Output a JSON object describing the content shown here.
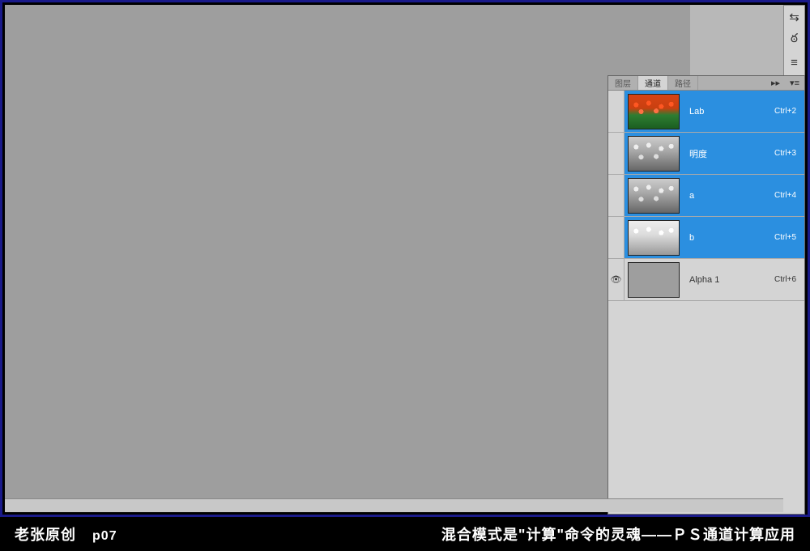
{
  "panel": {
    "tabs": {
      "layers": "图层",
      "channels": "通道",
      "paths": "路径"
    }
  },
  "channels": [
    {
      "name": "Lab",
      "shortcut": "Ctrl+2",
      "selected": true,
      "visible": false,
      "thumb": "color"
    },
    {
      "name": "明度",
      "shortcut": "Ctrl+3",
      "selected": true,
      "visible": false,
      "thumb": "gray"
    },
    {
      "name": "a",
      "shortcut": "Ctrl+4",
      "selected": true,
      "visible": false,
      "thumb": "gray"
    },
    {
      "name": "b",
      "shortcut": "Ctrl+5",
      "selected": true,
      "visible": false,
      "thumb": "light"
    },
    {
      "name": "Alpha 1",
      "shortcut": "Ctrl+6",
      "selected": false,
      "visible": true,
      "thumb": "alpha"
    }
  ],
  "footer": {
    "author": "老张原创",
    "page": "p07",
    "title": "混合模式是\"计算\"命令的灵魂——ＰＳ通道计算应用"
  }
}
